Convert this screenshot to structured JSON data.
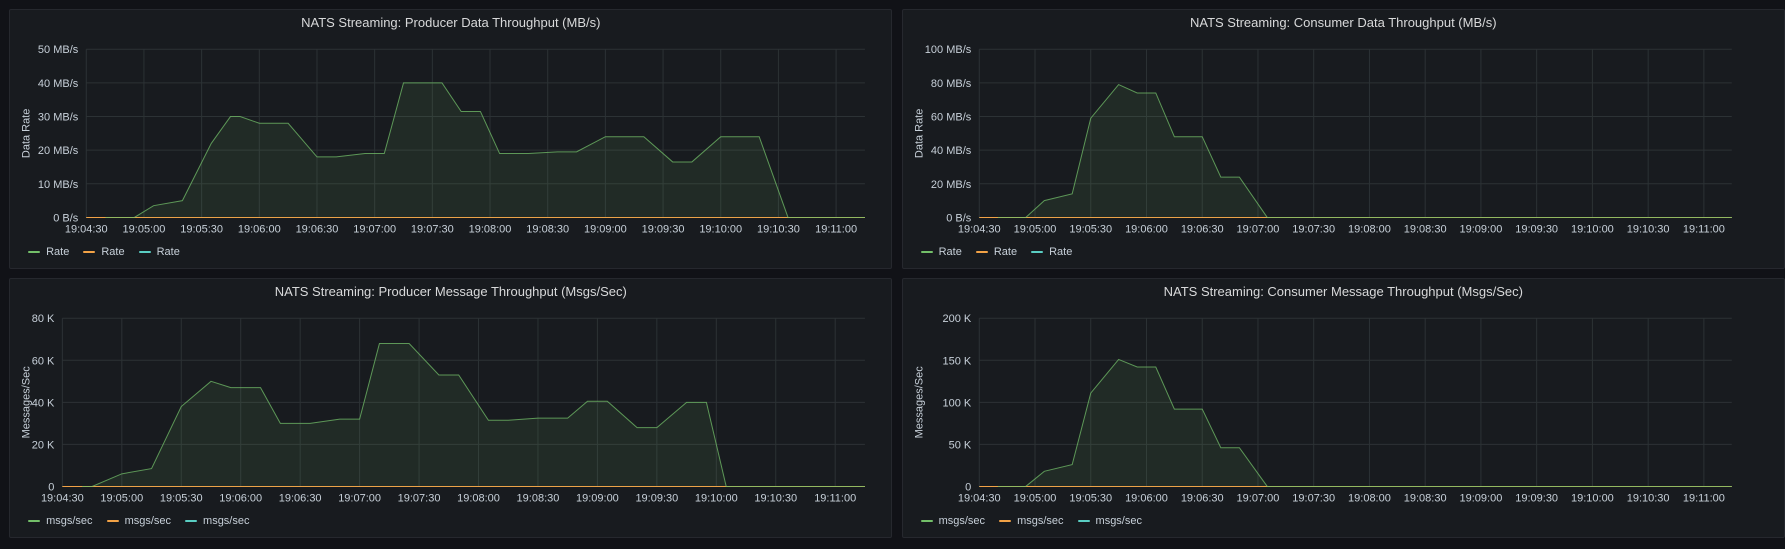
{
  "colors": {
    "series": [
      "#73bf69",
      "#f2a246",
      "#5acec3"
    ],
    "grid": "#2c3235",
    "area": "#1e2a1f"
  },
  "chart_data": [
    {
      "type": "area",
      "title": "NATS Streaming: Producer Data Throughput (MB/s)",
      "ylabel": "Data Rate",
      "yticks": [
        "0 B/s",
        "10 MB/s",
        "20 MB/s",
        "30 MB/s",
        "40 MB/s",
        "50 MB/s"
      ],
      "ylim": [
        0,
        50
      ],
      "xticks": [
        "19:04:30",
        "19:05:00",
        "19:05:30",
        "19:06:00",
        "19:06:30",
        "19:07:00",
        "19:07:30",
        "19:08:00",
        "19:08:30",
        "19:09:00",
        "19:09:30",
        "19:10:00",
        "19:10:30",
        "19:11:00"
      ],
      "xlim": [
        "19:04:30",
        "19:11:15"
      ],
      "legend": [
        "Rate",
        "Rate",
        "Rate"
      ],
      "series": [
        {
          "x": [
            "19:04:40",
            "19:04:55",
            "19:05:05",
            "19:05:20",
            "19:05:35",
            "19:05:45",
            "19:05:50",
            "19:06:00",
            "19:06:05",
            "19:06:15",
            "19:06:30",
            "19:06:40",
            "19:06:55",
            "19:07:05",
            "19:07:15",
            "19:07:25",
            "19:07:35",
            "19:07:45",
            "19:07:55",
            "19:08:05",
            "19:08:20",
            "19:08:35",
            "19:08:45",
            "19:09:00",
            "19:09:10",
            "19:09:20",
            "19:09:35",
            "19:09:45",
            "19:10:00",
            "19:10:05",
            "19:10:20",
            "19:10:35",
            "19:10:45",
            "19:11:00",
            "19:11:15"
          ],
          "values": [
            0,
            0,
            3.5,
            5,
            22,
            30,
            30,
            28,
            28,
            28,
            18,
            18,
            19,
            19,
            40,
            40,
            40,
            31.5,
            31.5,
            19,
            19,
            19.5,
            19.5,
            24,
            24,
            24,
            16.5,
            16.5,
            24,
            24,
            24,
            0,
            0,
            0,
            0
          ]
        },
        {
          "x": [
            "19:04:30",
            "19:11:15"
          ],
          "values": [
            0,
            0
          ]
        },
        {
          "x": [
            "19:04:30",
            "19:11:15"
          ],
          "values": [
            0,
            0
          ]
        }
      ]
    },
    {
      "type": "area",
      "title": "NATS Streaming: Consumer Data Throughput (MB/s)",
      "ylabel": "Data Rate",
      "yticks": [
        "0 B/s",
        "20 MB/s",
        "40 MB/s",
        "60 MB/s",
        "80 MB/s",
        "100 MB/s"
      ],
      "ylim": [
        0,
        100
      ],
      "xticks": [
        "19:04:30",
        "19:05:00",
        "19:05:30",
        "19:06:00",
        "19:06:30",
        "19:07:00",
        "19:07:30",
        "19:08:00",
        "19:08:30",
        "19:09:00",
        "19:09:30",
        "19:10:00",
        "19:10:30",
        "19:11:00"
      ],
      "xlim": [
        "19:04:30",
        "19:11:15"
      ],
      "legend": [
        "Rate",
        "Rate",
        "Rate"
      ],
      "series": [
        {
          "x": [
            "19:04:40",
            "19:04:55",
            "19:05:05",
            "19:05:20",
            "19:05:30",
            "19:05:45",
            "19:05:55",
            "19:06:05",
            "19:06:15",
            "19:06:30",
            "19:06:40",
            "19:06:50",
            "19:07:05",
            "19:07:15",
            "19:07:25",
            "19:07:35",
            "19:11:15"
          ],
          "values": [
            0,
            0,
            10,
            14,
            59,
            79,
            74,
            74,
            48,
            48,
            24,
            24,
            0,
            0,
            0,
            0,
            0
          ]
        },
        {
          "x": [
            "19:04:30",
            "19:11:15"
          ],
          "values": [
            0,
            0
          ]
        },
        {
          "x": [
            "19:04:30",
            "19:11:15"
          ],
          "values": [
            0,
            0
          ]
        }
      ]
    },
    {
      "type": "area",
      "title": "NATS Streaming: Producer Message Throughput (Msgs/Sec)",
      "ylabel": "Messages/Sec",
      "yticks": [
        "0",
        "20 K",
        "40 K",
        "60 K",
        "80 K"
      ],
      "ylim": [
        0,
        80000
      ],
      "xticks": [
        "19:04:30",
        "19:05:00",
        "19:05:30",
        "19:06:00",
        "19:06:30",
        "19:07:00",
        "19:07:30",
        "19:08:00",
        "19:08:30",
        "19:09:00",
        "19:09:30",
        "19:10:00",
        "19:10:30",
        "19:11:00"
      ],
      "xlim": [
        "19:04:30",
        "19:11:15"
      ],
      "legend": [
        "msgs/sec",
        "msgs/sec",
        "msgs/sec"
      ],
      "series": [
        {
          "x": [
            "19:04:40",
            "19:04:45",
            "19:05:00",
            "19:05:15",
            "19:05:30",
            "19:05:45",
            "19:05:55",
            "19:06:10",
            "19:06:20",
            "19:06:35",
            "19:06:50",
            "19:07:00",
            "19:07:10",
            "19:07:25",
            "19:07:40",
            "19:07:50",
            "19:08:05",
            "19:08:15",
            "19:08:30",
            "19:08:45",
            "19:08:55",
            "19:09:05",
            "19:09:20",
            "19:09:30",
            "19:09:45",
            "19:09:55",
            "19:10:05",
            "19:10:15",
            "19:10:30",
            "19:10:35",
            "19:10:55",
            "19:11:15"
          ],
          "values": [
            0,
            0,
            6000,
            8500,
            38000,
            50000,
            47000,
            47000,
            30000,
            30000,
            32000,
            32000,
            68000,
            68000,
            53000,
            53000,
            31500,
            31500,
            32500,
            32500,
            40500,
            40500,
            28000,
            28000,
            40000,
            40000,
            0,
            0,
            0,
            0,
            0,
            0
          ]
        },
        {
          "x": [
            "19:04:30",
            "19:11:15"
          ],
          "values": [
            0,
            0
          ]
        },
        {
          "x": [
            "19:04:30",
            "19:11:15"
          ],
          "values": [
            0,
            0
          ]
        }
      ]
    },
    {
      "type": "area",
      "title": "NATS Streaming: Consumer Message Throughput (Msgs/Sec)",
      "ylabel": "Messages/Sec",
      "yticks": [
        "0",
        "50 K",
        "100 K",
        "150 K",
        "200 K"
      ],
      "ylim": [
        0,
        200000
      ],
      "xticks": [
        "19:04:30",
        "19:05:00",
        "19:05:30",
        "19:06:00",
        "19:06:30",
        "19:07:00",
        "19:07:30",
        "19:08:00",
        "19:08:30",
        "19:09:00",
        "19:09:30",
        "19:10:00",
        "19:10:30",
        "19:11:00"
      ],
      "xlim": [
        "19:04:30",
        "19:11:15"
      ],
      "legend": [
        "msgs/sec",
        "msgs/sec",
        "msgs/sec"
      ],
      "series": [
        {
          "x": [
            "19:04:40",
            "19:04:55",
            "19:05:05",
            "19:05:20",
            "19:05:30",
            "19:05:45",
            "19:05:55",
            "19:06:05",
            "19:06:15",
            "19:06:30",
            "19:06:40",
            "19:06:50",
            "19:07:05",
            "19:07:15",
            "19:07:25",
            "19:07:35",
            "19:11:15"
          ],
          "values": [
            0,
            0,
            18000,
            26000,
            111000,
            151000,
            142000,
            142000,
            92000,
            92000,
            46000,
            46000,
            0,
            0,
            0,
            0,
            0
          ]
        },
        {
          "x": [
            "19:04:30",
            "19:11:15"
          ],
          "values": [
            0,
            0
          ]
        },
        {
          "x": [
            "19:04:30",
            "19:11:15"
          ],
          "values": [
            0,
            0
          ]
        }
      ]
    }
  ]
}
